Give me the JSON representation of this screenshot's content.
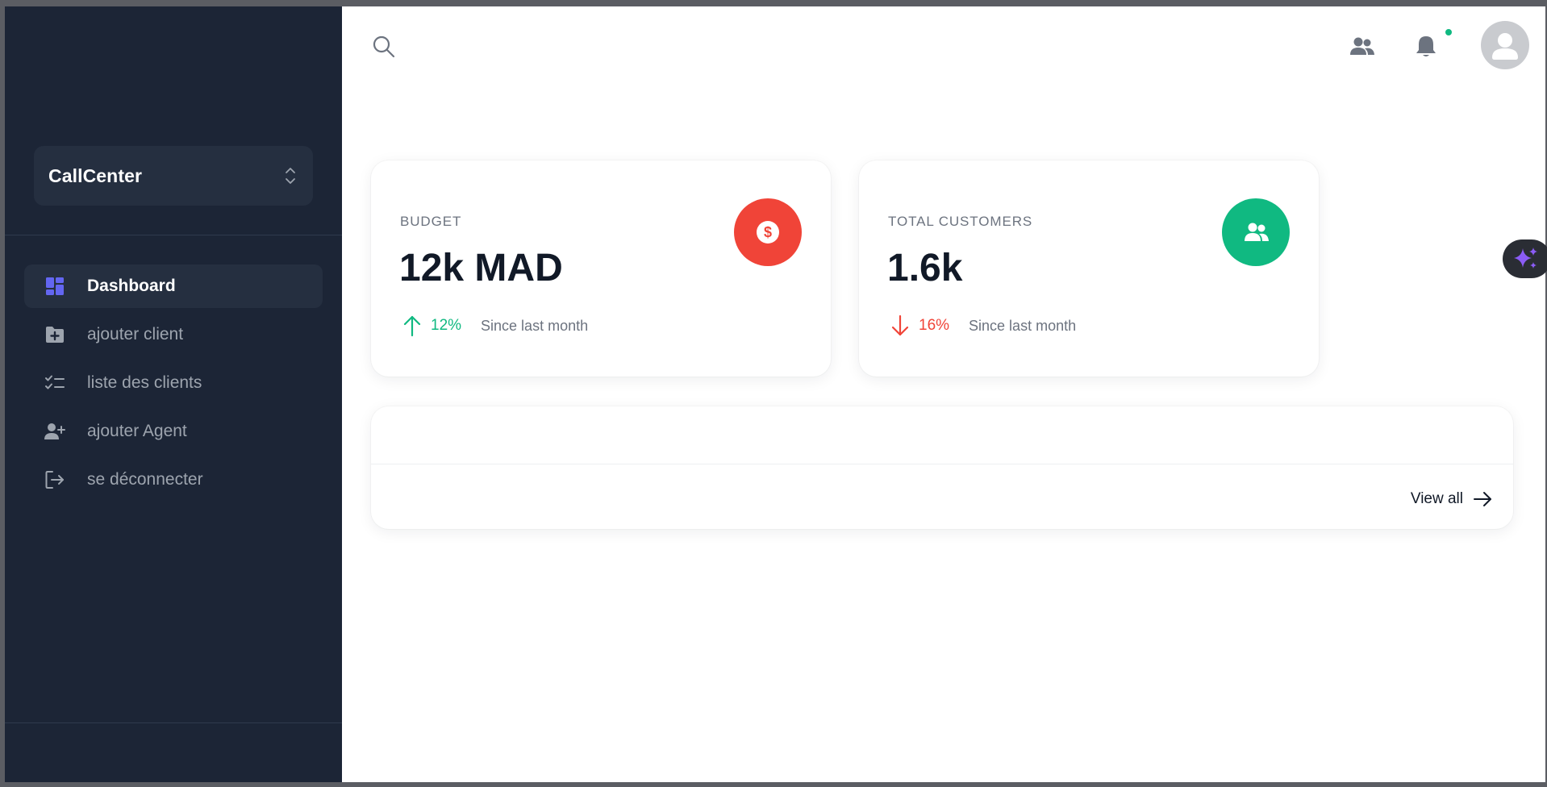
{
  "sidebar": {
    "workspace": {
      "name": "CallCenter"
    },
    "items": [
      {
        "label": "Dashboard",
        "icon": "dashboard-icon",
        "active": true
      },
      {
        "label": "ajouter client",
        "icon": "folder-plus-icon",
        "active": false
      },
      {
        "label": "liste des clients",
        "icon": "checklist-icon",
        "active": false
      },
      {
        "label": "ajouter Agent",
        "icon": "user-plus-icon",
        "active": false
      },
      {
        "label": "se déconnecter",
        "icon": "logout-icon",
        "active": false
      }
    ]
  },
  "topbar": {
    "icons": [
      "search-icon",
      "users-icon",
      "bell-icon",
      "avatar-icon"
    ]
  },
  "cards": [
    {
      "label": "BUDGET",
      "value": "12k MAD",
      "icon": "dollar-icon",
      "color": "#f04438",
      "trend": {
        "direction": "up",
        "percent": "12%",
        "color": "#10b981",
        "note": "Since last month"
      }
    },
    {
      "label": "TOTAL CUSTOMERS",
      "value": "1.6k",
      "icon": "users-icon",
      "color": "#10b981",
      "trend": {
        "direction": "down",
        "percent": "16%",
        "color": "#f04438",
        "note": "Since last month"
      }
    }
  ],
  "panel": {
    "view_all_label": "View all"
  },
  "colors": {
    "sidebar_bg": "#1c2536",
    "sidebar_active_bg": "#252f40",
    "accent": "#6366f1",
    "success": "#10b981",
    "error": "#f04438"
  }
}
